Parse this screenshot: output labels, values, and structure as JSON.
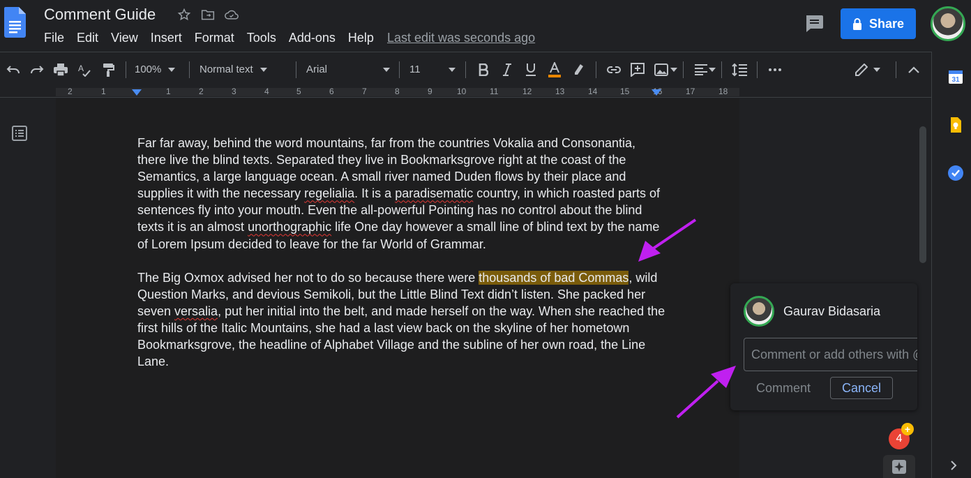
{
  "app": {
    "doc_title": "Comment Guide",
    "last_edit": "Last edit was seconds ago",
    "share_label": "Share"
  },
  "menu": [
    "File",
    "Edit",
    "View",
    "Insert",
    "Format",
    "Tools",
    "Add-ons",
    "Help"
  ],
  "toolbar": {
    "zoom": "100%",
    "style": "Normal text",
    "font": "Arial",
    "size": "11"
  },
  "ruler": {
    "labels": [
      "2",
      "1",
      "1",
      "2",
      "3",
      "4",
      "5",
      "6",
      "7",
      "8",
      "9",
      "10",
      "11",
      "12",
      "13",
      "14",
      "15",
      "16",
      "17",
      "18"
    ]
  },
  "document": {
    "p1": {
      "a": "Far far away, behind the word mountains, far from the countries Vokalia and Consonantia, there live the blind texts. Separated they live in Bookmarksgrove right at the coast of the Semantics, a large language ocean. A small river named Duden flows by their place and supplies it with the necessary ",
      "s1": "regelialia",
      "b": ". It is a ",
      "s2": "paradisematic",
      "c": " country, in which roasted parts of sentences fly into your mouth. Even the all-powerful Pointing has no control about the blind texts it is an almost ",
      "s3": "unorthographic",
      "d": " life One day however a small line of blind text by the name of Lorem Ipsum decided to leave for the far World of Grammar."
    },
    "p2": {
      "a": "The Big Oxmox advised her not to do so because there were ",
      "highlight": "thousands of bad Commas",
      "b": ", wild Question Marks, and devious Semikoli, but the Little Blind Text didn’t listen. She packed her seven ",
      "s1": "versalia",
      "c": ", put her initial into the belt, and made herself on the way. When she reached the first hills of the Italic Mountains, she had a last view back on the skyline of her hometown Bookmarksgrove, the headline of Alphabet Village and the subline of her own road, the Line Lane."
    }
  },
  "comment": {
    "author": "Gaurav Bidasaria",
    "placeholder": "Comment or add others with @",
    "comment_label": "Comment",
    "cancel_label": "Cancel"
  },
  "notifications": {
    "count": "4",
    "plus": "+"
  },
  "colors": {
    "accent": "#1a73e8",
    "highlight": "#7a5c0b",
    "annotation_arrow": "#c020f0"
  }
}
